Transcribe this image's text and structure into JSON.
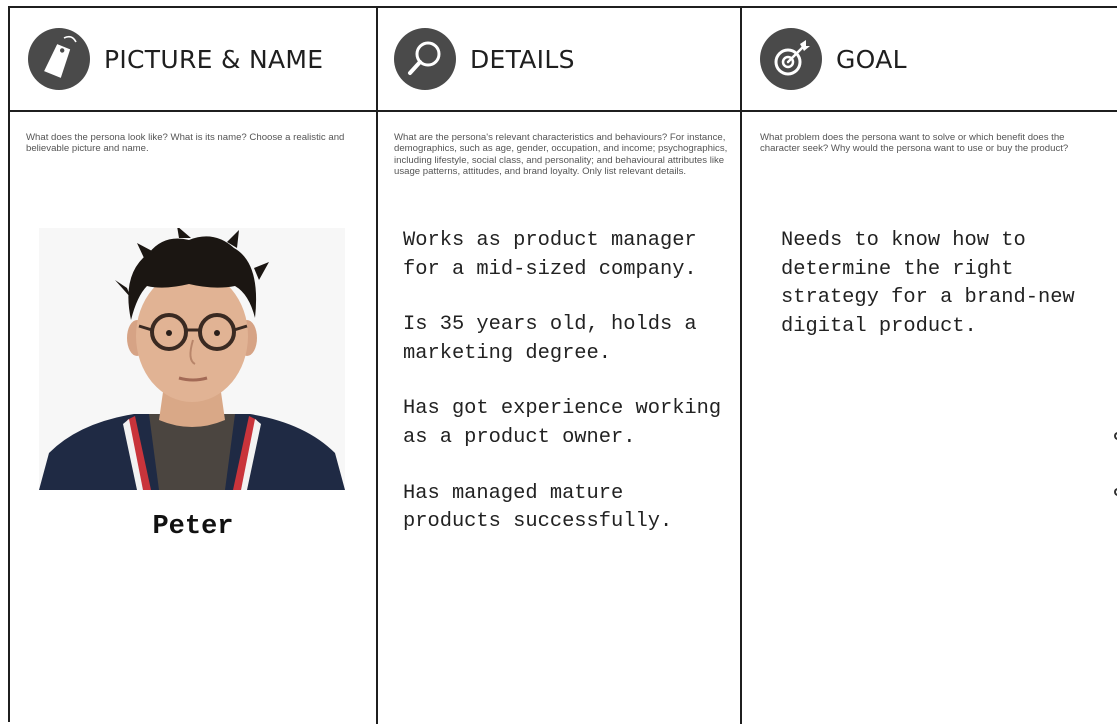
{
  "columns": [
    {
      "title": "PICTURE & NAME",
      "icon": "tag-icon",
      "hint": "What does the persona look like? What is its name? Choose a realistic and believable picture and name.",
      "persona_name": "Peter"
    },
    {
      "title": "DETAILS",
      "icon": "magnifier-icon",
      "hint": "What are the persona's relevant characteristics and behaviours? For instance, demographics, such as age, gender, occupation, and income; psychographics, including lifestyle, social class, and personality; and behavioural attributes like usage patterns, attitudes, and brand loyalty. Only list relevant details.",
      "notes": [
        "Works as product manager for a mid-sized company.",
        "Is 35 years old, holds a marketing degree.",
        "Has got experience working as a product owner.",
        "Has managed mature products successfully."
      ]
    },
    {
      "title": "GOAL",
      "icon": "target-icon",
      "hint": "What problem does the persona want to solve or which benefit does the character seek? Why would the persona want to use or buy the product?",
      "notes": [
        "Needs to know how to determine the right strategy for a brand-new digital product."
      ]
    }
  ],
  "colors": {
    "line": "#1f1f1f",
    "icon_bg": "#4a4a4a",
    "hint_text": "#555555"
  }
}
